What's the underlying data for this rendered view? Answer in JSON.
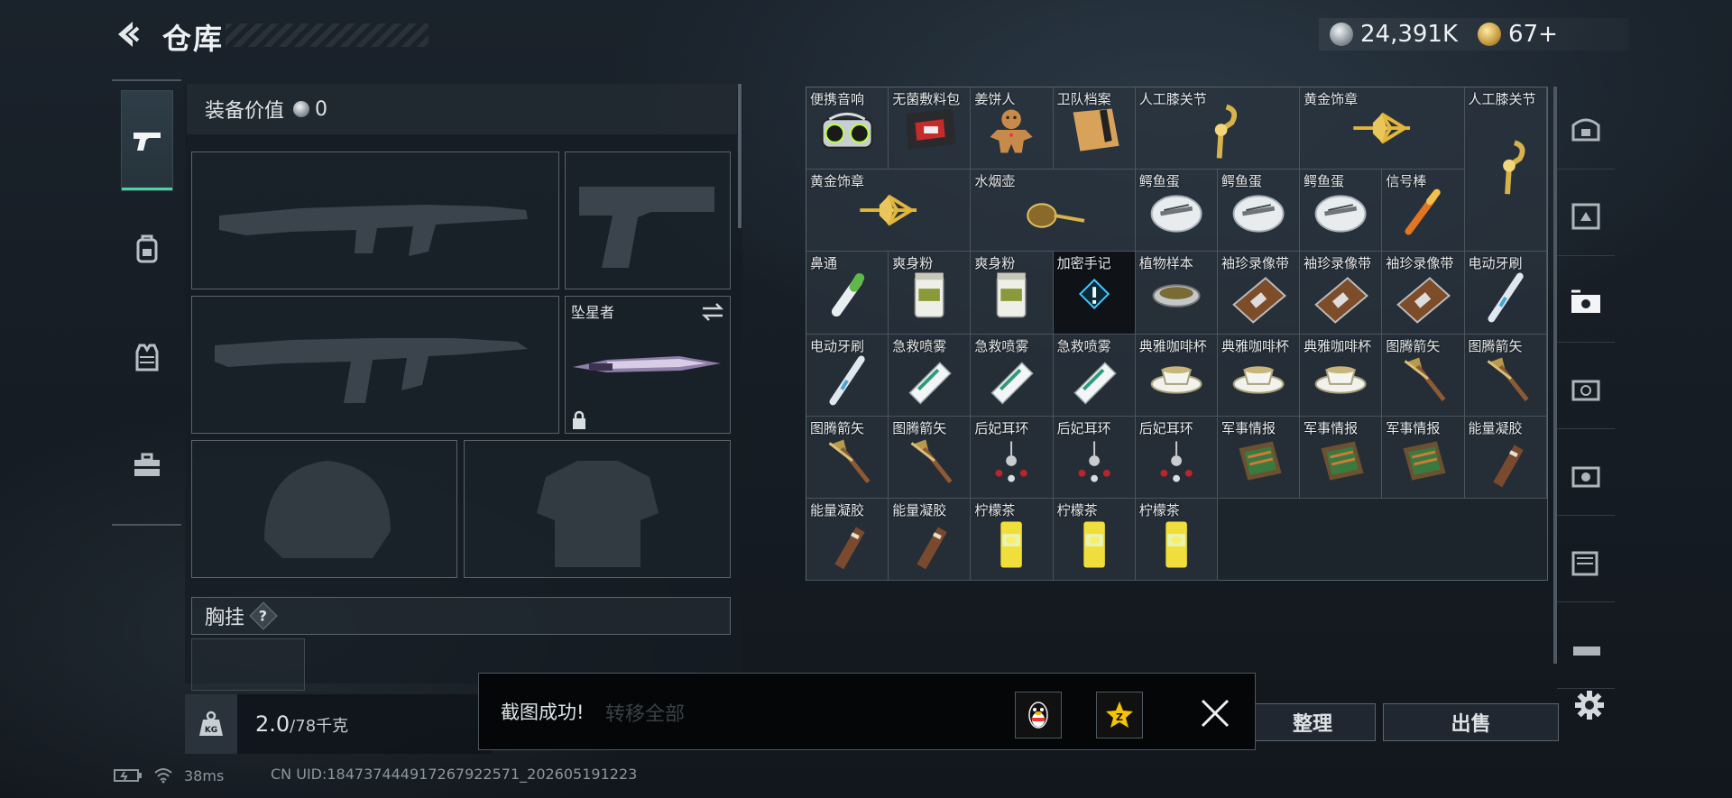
{
  "title": "仓库",
  "currency": {
    "silver": "24,391K",
    "gold": "67+"
  },
  "sidebar": {
    "tabs": [
      {
        "icon": "pistol-icon",
        "active": true
      },
      {
        "icon": "backpack-icon",
        "active": false
      },
      {
        "icon": "vest-icon",
        "active": false
      },
      {
        "icon": "toolbox-icon",
        "active": false
      }
    ]
  },
  "equipment": {
    "header_label": "装备价值",
    "header_value": "0",
    "melee_name": "坠星者",
    "chest_label": "胸挂",
    "help_symbol": "?"
  },
  "weight": {
    "current": "2.0",
    "max": "/78千克"
  },
  "inventory": {
    "items": [
      {
        "label": "便携音响",
        "icon": "speaker"
      },
      {
        "label": "无菌敷料包",
        "icon": "bandage-pack"
      },
      {
        "label": "姜饼人",
        "icon": "gingerbread"
      },
      {
        "label": "卫队档案",
        "icon": "folder"
      },
      {
        "label": "人工膝关节",
        "icon": "knee-joint"
      },
      {
        "label": "人工膝关节",
        "icon": "knee-joint"
      },
      {
        "label": "黄金饰章",
        "icon": "gold-badge"
      },
      {
        "label": "黄金饰章",
        "icon": "gold-badge"
      },
      {
        "label": "水烟壶",
        "icon": "hookah"
      },
      {
        "label": "鳄鱼蛋",
        "icon": "croc-egg"
      },
      {
        "label": "鳄鱼蛋",
        "icon": "croc-egg"
      },
      {
        "label": "鳄鱼蛋",
        "icon": "croc-egg"
      },
      {
        "label": "信号棒",
        "icon": "flare"
      },
      {
        "label": "鼻通",
        "icon": "inhaler"
      },
      {
        "label": "爽身粉",
        "icon": "powder"
      },
      {
        "label": "爽身粉",
        "icon": "powder"
      },
      {
        "label": "加密手记",
        "icon": "encrypted"
      },
      {
        "label": "植物样本",
        "icon": "plant-sample"
      },
      {
        "label": "袖珍录像带",
        "icon": "tape"
      },
      {
        "label": "袖珍录像带",
        "icon": "tape"
      },
      {
        "label": "袖珍录像带",
        "icon": "tape"
      },
      {
        "label": "电动牙刷",
        "icon": "toothbrush"
      },
      {
        "label": "电动牙刷",
        "icon": "toothbrush"
      },
      {
        "label": "急救喷雾",
        "icon": "spray"
      },
      {
        "label": "急救喷雾",
        "icon": "spray"
      },
      {
        "label": "急救喷雾",
        "icon": "spray"
      },
      {
        "label": "典雅咖啡杯",
        "icon": "cup"
      },
      {
        "label": "典雅咖啡杯",
        "icon": "cup"
      },
      {
        "label": "典雅咖啡杯",
        "icon": "cup"
      },
      {
        "label": "图腾箭矢",
        "icon": "arrow"
      },
      {
        "label": "图腾箭矢",
        "icon": "arrow"
      },
      {
        "label": "图腾箭矢",
        "icon": "arrow"
      },
      {
        "label": "图腾箭矢",
        "icon": "arrow"
      },
      {
        "label": "后妃耳环",
        "icon": "earring"
      },
      {
        "label": "后妃耳环",
        "icon": "earring"
      },
      {
        "label": "后妃耳环",
        "icon": "earring"
      },
      {
        "label": "军事情报",
        "icon": "intel"
      },
      {
        "label": "军事情报",
        "icon": "intel"
      },
      {
        "label": "军事情报",
        "icon": "intel"
      },
      {
        "label": "能量凝胶",
        "icon": "gel"
      },
      {
        "label": "能量凝胶",
        "icon": "gel"
      },
      {
        "label": "能量凝胶",
        "icon": "gel"
      },
      {
        "label": "柠檬茶",
        "icon": "lemon-tea"
      },
      {
        "label": "柠檬茶",
        "icon": "lemon-tea"
      },
      {
        "label": "柠檬茶",
        "icon": "lemon-tea"
      }
    ]
  },
  "right_nav": [
    {
      "icon": "safe-box-icon"
    },
    {
      "icon": "storage-2-icon"
    },
    {
      "icon": "storage-3-icon",
      "active": true
    },
    {
      "icon": "storage-4-icon"
    },
    {
      "icon": "storage-5-icon"
    },
    {
      "icon": "storage-6-icon"
    },
    {
      "icon": "storage-7-icon"
    }
  ],
  "actions": {
    "sort": "整理",
    "sell": "出售"
  },
  "toast": {
    "message": "截图成功!",
    "ghost_text": "转移全部"
  },
  "status": {
    "ping": "38ms",
    "uid": "CN UID:18473744491726792257​1_202605191223"
  },
  "colors": {
    "accent": "#49d4a0",
    "gold": "#d6a63a"
  }
}
